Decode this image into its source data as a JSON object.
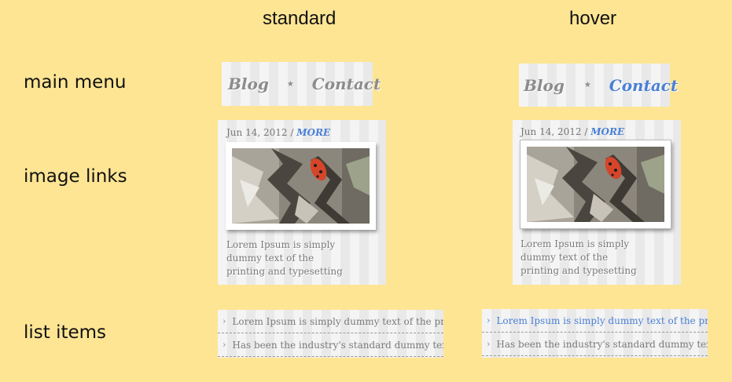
{
  "columns": {
    "standard": "standard",
    "hover": "hover"
  },
  "rows": {
    "main_menu": "main menu",
    "image_links": "image links",
    "list_items": "list items"
  },
  "menu": {
    "item_1": "Blog",
    "item_2": "Contact",
    "separator": "★"
  },
  "card": {
    "date": "Jun 14, 2012",
    "slash": "/",
    "more": "MORE",
    "excerpt_lines": [
      "Lorem Ipsum is simply",
      "dummy text of the",
      "printing and typesetting"
    ]
  },
  "list": {
    "items": [
      "Lorem Ipsum is simply dummy text of the printing",
      "Has been the industry's standard dummy text"
    ],
    "chevron": "›"
  },
  "colors": {
    "background": "#fde594",
    "hover_blue": "#4a7fd6",
    "text_gray": "#7a7a7a"
  }
}
